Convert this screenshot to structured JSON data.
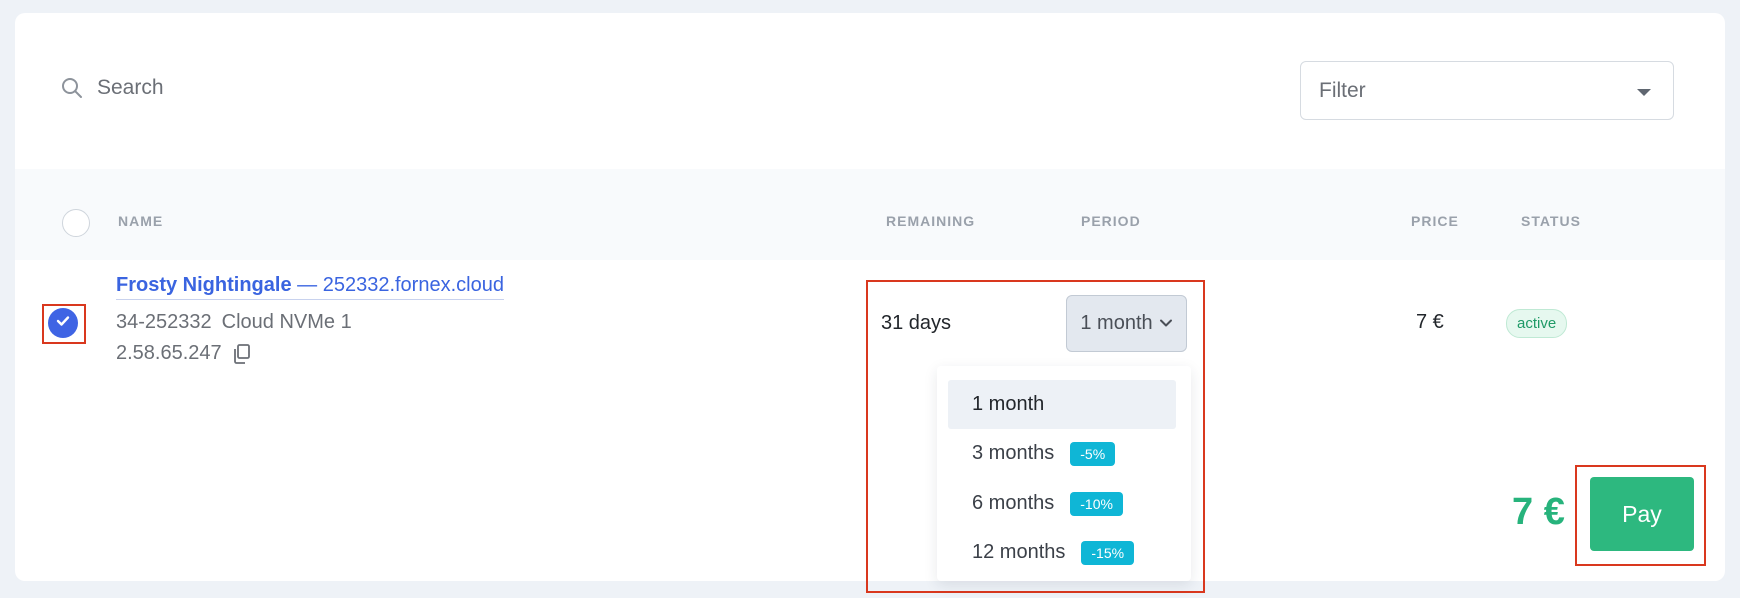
{
  "search": {
    "placeholder": "Search"
  },
  "filter": {
    "label": "Filter"
  },
  "table": {
    "headers": {
      "name": "NAME",
      "remaining": "REMAINING",
      "period": "PERIOD",
      "price": "PRICE",
      "status": "STATUS"
    },
    "rows": [
      {
        "selected": true,
        "name": "Frosty Nightingale",
        "separator": "—",
        "host": "252332.fornex.cloud",
        "id": "34-252332",
        "plan": "Cloud NVMe 1",
        "ip": "2.58.65.247",
        "remaining": "31 days",
        "period": "1 month",
        "price": "7 €",
        "status": "active"
      }
    ]
  },
  "period_dropdown": {
    "options": [
      {
        "label": "1 month",
        "discount": "",
        "selected": true
      },
      {
        "label": "3 months",
        "discount": "-5%"
      },
      {
        "label": "6 months",
        "discount": "-10%"
      },
      {
        "label": "12 months",
        "discount": "-15%"
      }
    ]
  },
  "footer": {
    "total": "7 €",
    "pay_label": "Pay"
  },
  "colors": {
    "accent": "#3f64e4",
    "pay": "#2db87f",
    "badge": "#0fb6d6",
    "highlight": "#d9381e"
  }
}
